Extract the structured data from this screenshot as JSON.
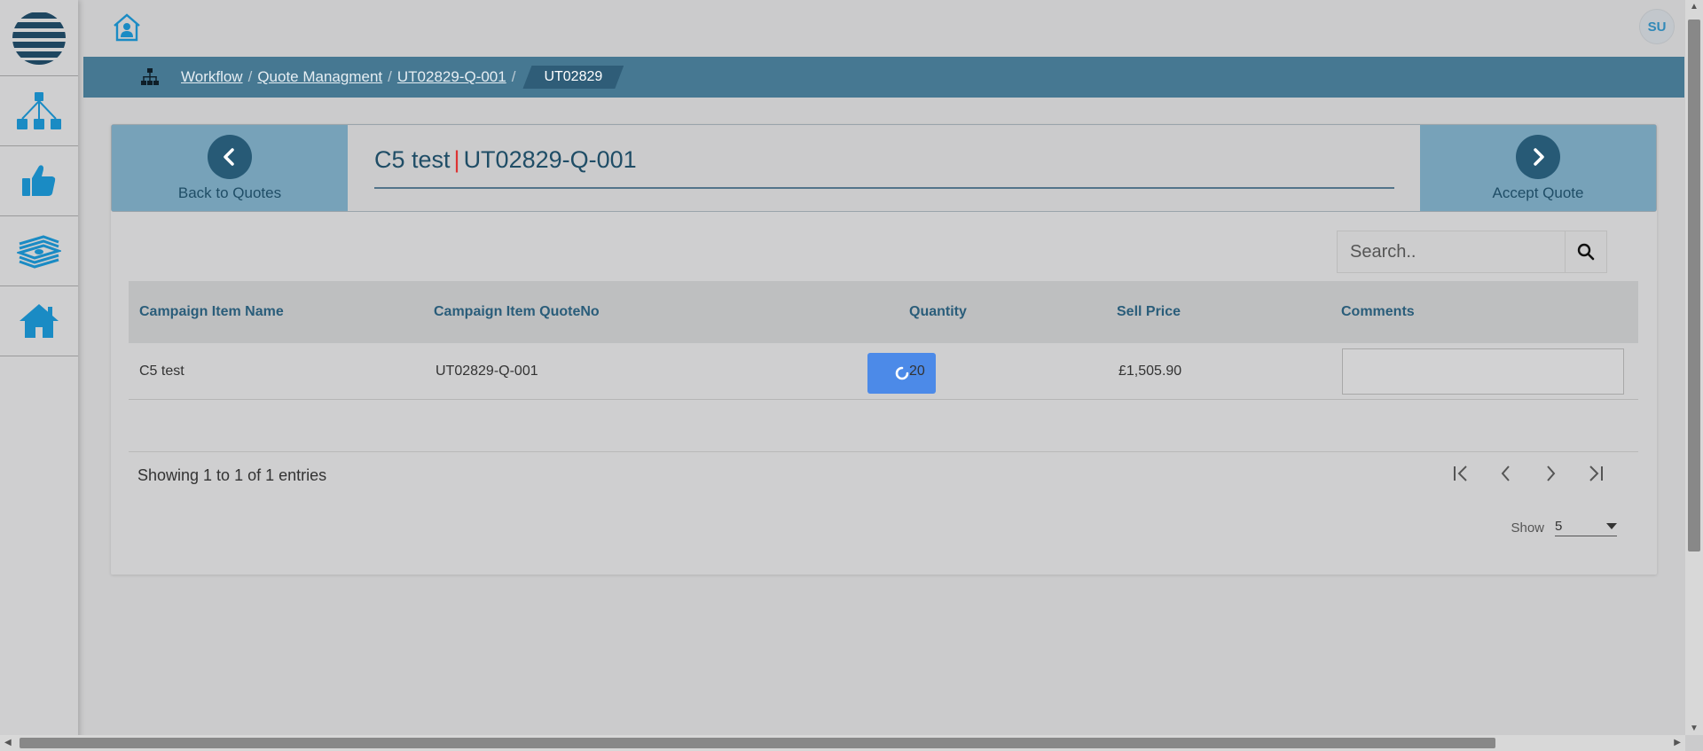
{
  "topbar": {
    "avatar_initials": "SU"
  },
  "breadcrumb": {
    "items": [
      "Workflow",
      "Quote Managment",
      "UT02829-Q-001"
    ],
    "current": "UT02829"
  },
  "header": {
    "back_label": "Back to Quotes",
    "accept_label": "Accept Quote",
    "title_name": "C5 test",
    "title_separator": "|",
    "title_quote": "UT02829-Q-001"
  },
  "search": {
    "placeholder": "Search.."
  },
  "table": {
    "columns": [
      "Campaign Item Name",
      "Campaign Item QuoteNo",
      "Quantity",
      "Sell Price",
      "Comments"
    ],
    "rows": [
      {
        "name": "C5 test",
        "quote_no": "UT02829-Q-001",
        "quantity": "20",
        "sell_price": "£1,505.90",
        "comments": ""
      }
    ]
  },
  "footer": {
    "info": "Showing 1 to 1 of 1 entries",
    "show_label": "Show",
    "page_size": "5"
  },
  "colors": {
    "brand_dark": "#275a76",
    "brand": "#467892",
    "accent_blue": "#1a8bc4",
    "spinner": "#4c8ae8"
  },
  "icons": {
    "sidebar": [
      "globe-logo-icon",
      "workflow-tree-icon",
      "thumbs-up-icon",
      "money-stack-icon",
      "home-icon"
    ]
  }
}
